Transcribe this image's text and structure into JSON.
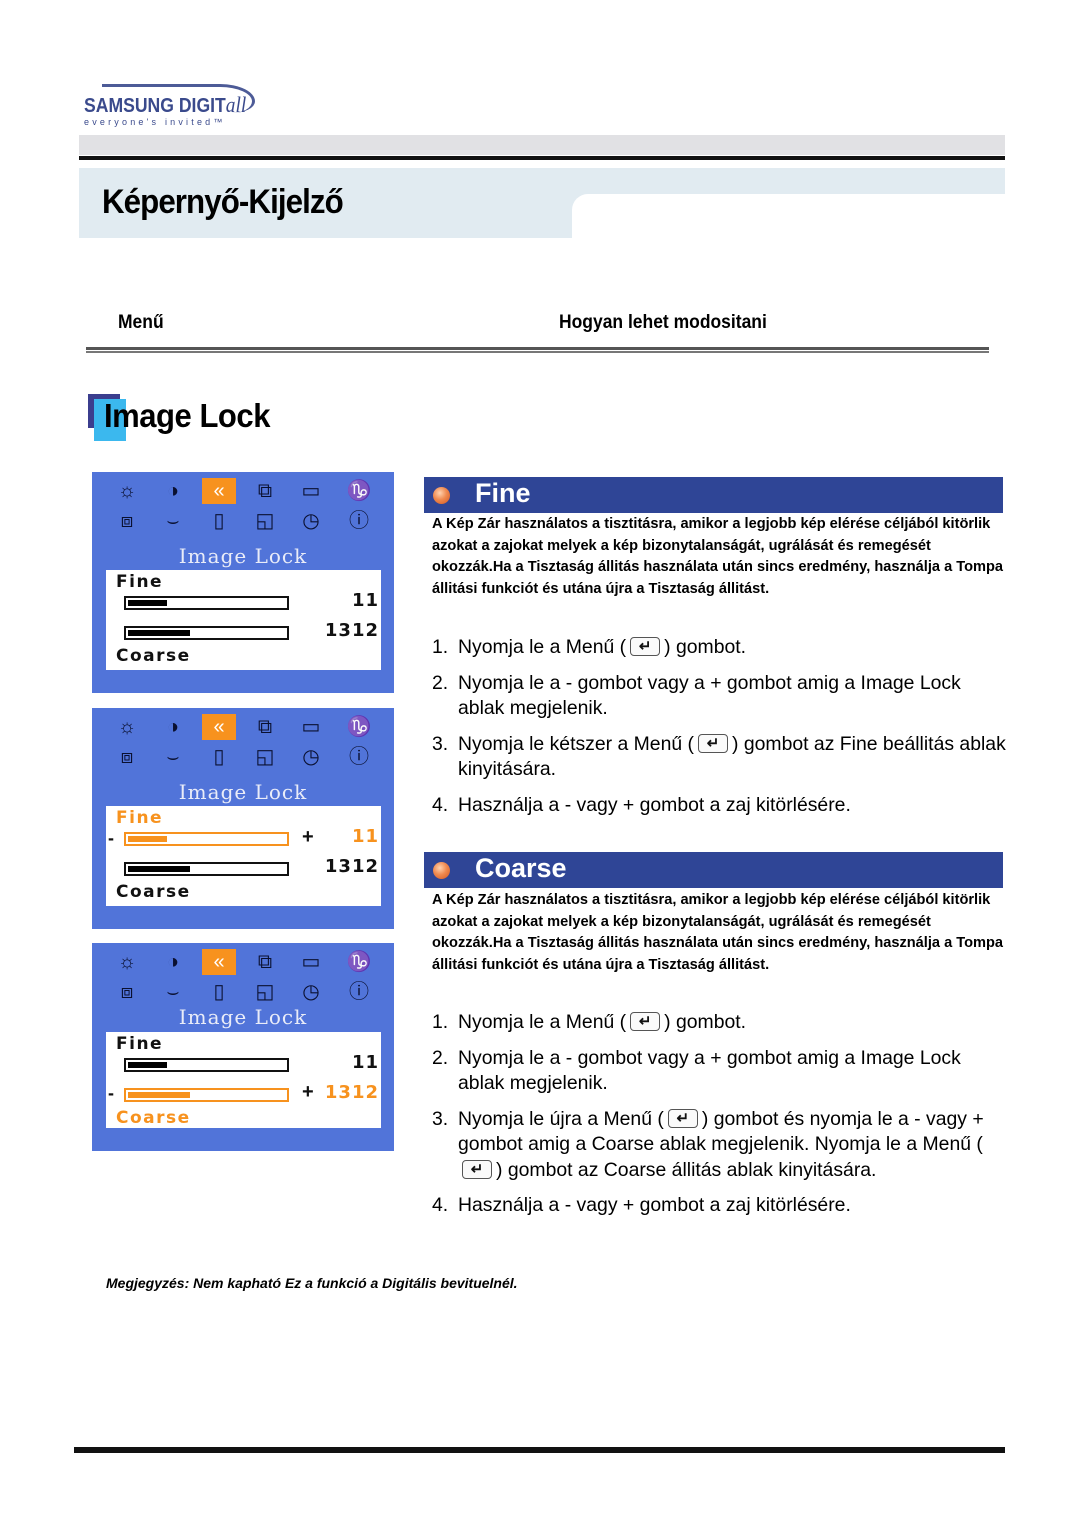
{
  "logo": {
    "brand": "SAMSUNG DIGIT",
    "brand_suffix": "all",
    "tagline": "everyone's invited™"
  },
  "header": {
    "title": "Képernyő-Kijelző"
  },
  "columns": {
    "left": "Menű",
    "right": "Hogyan lehet modositani"
  },
  "section": {
    "title": "Image Lock"
  },
  "osd_icons": [
    "brightness-icon",
    "contrast-icon",
    "image-lock-icon",
    "position-icon",
    "size-icon",
    "color-temperature-icon",
    "zoom-icon",
    "recall-icon",
    "pip-icon",
    "window-icon",
    "timer-icon",
    "information-icon"
  ],
  "osd_icon_glyphs": [
    "☼",
    "◑",
    "⧉",
    "⧉",
    "▭",
    "🌡K",
    "⬚",
    "◠",
    "▯▯",
    "◱",
    "◷",
    "ⓘ"
  ],
  "osd_panels": [
    {
      "title": "Image Lock",
      "fine_label": "Fine",
      "fine_value": "11",
      "fine_level": 0.27,
      "coarse_label": "Coarse",
      "coarse_value": "1312",
      "coarse_level": 0.41,
      "active": "none"
    },
    {
      "title": "Image Lock",
      "fine_label": "Fine",
      "fine_value": "11",
      "fine_level": 0.27,
      "coarse_label": "Coarse",
      "coarse_value": "1312",
      "coarse_level": 0.41,
      "active": "fine",
      "minus": "-",
      "plus": "+"
    },
    {
      "title": "Image Lock",
      "fine_label": "Fine",
      "fine_value": "11",
      "fine_level": 0.27,
      "coarse_label": "Coarse",
      "coarse_value": "1312",
      "coarse_level": 0.41,
      "active": "coarse",
      "minus": "-",
      "plus": "+"
    }
  ],
  "fine": {
    "title": "Fine",
    "description": "A Kép Zár használatos a tisztitásra, amikor a legjobb kép elérése céljából kitörlik azokat a zajokat melyek a kép bizonytalanságát, ugrálását és remegését okozzák.Ha a Tisztaság állitás használata után sincs eredmény, használja a Tompa állitási funkciót és utána újra a Tisztaság állitást.",
    "steps": [
      {
        "num": "1.",
        "before": "Nyomja le a Menű  (",
        "after": ") gombot."
      },
      {
        "num": "2.",
        "text": "Nyomja le a - gombot vagy a + gombot amig a Image Lock ablak megjelenik."
      },
      {
        "num": "3.",
        "before": "Nyomja le kétszer a Menű (",
        "after": ") gombot az Fine beállitás ablak kinyitására."
      },
      {
        "num": "4.",
        "text": "Használja a - vagy + gombot a zaj kitörlésére."
      }
    ]
  },
  "coarse": {
    "title": "Coarse",
    "description": "A Kép Zár használatos a tisztitásra, amikor a legjobb kép elérése céljából kitörlik azokat a zajokat melyek a kép bizonytalanságát, ugrálását és remegését okozzák.Ha a Tisztaság állitás használata után sincs eredmény, használja a Tompa állitási funkciót és utána újra a Tisztaság állitást.",
    "steps": [
      {
        "num": "1.",
        "before": "Nyomja le a Menű  (",
        "after": ") gombot."
      },
      {
        "num": "2.",
        "text": "Nyomja le a - gombot vagy a + gombot amig a Image Lock ablak megjelenik."
      },
      {
        "num": "3.",
        "before": "Nyomja le újra a Menű (",
        "middle": ") gombot és nyomja le a - vagy + gombot amig a Coarse ablak megjelenik. Nyomja le a Menű (",
        "after": ")  gombot az Coarse állitás ablak kinyitására."
      },
      {
        "num": "4.",
        "text": "Használja a - vagy + gombot a zaj kitörlésére."
      }
    ]
  },
  "note": "Megjegyzés: Nem kapható Ez a funkció a Digitális bevituelnél.",
  "colors": {
    "osd_bg": "#5174d9",
    "osd_accent": "#f7921e",
    "subhead_bg": "#2f4596",
    "title_band": "#e1ebf1"
  }
}
